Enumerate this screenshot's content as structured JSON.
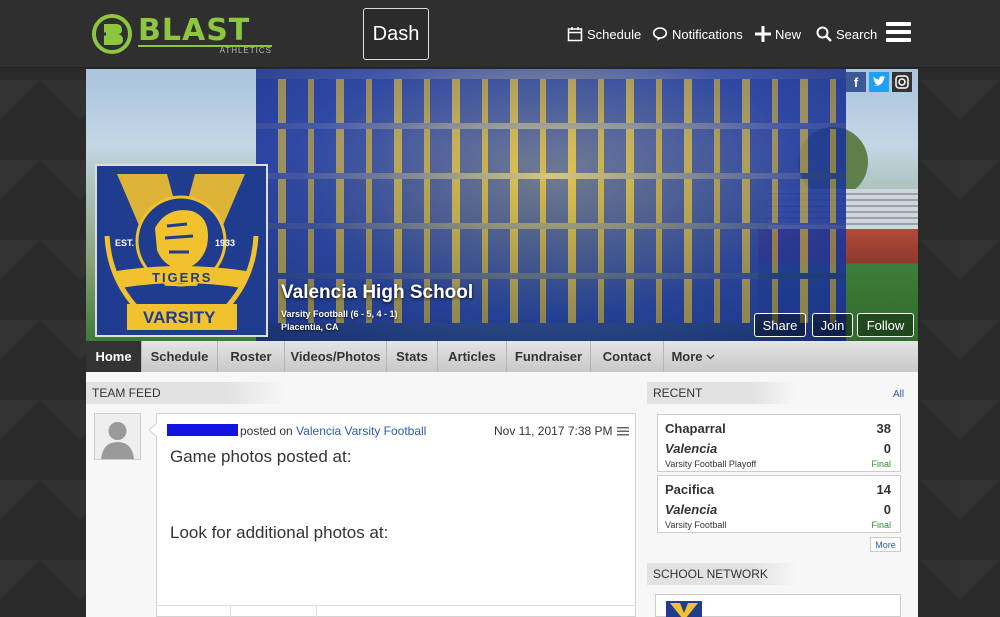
{
  "topbar": {
    "logo_text": "BLAST",
    "logo_sub": "ATHLETICS",
    "dash_label": "Dash",
    "nav": [
      {
        "label": "Schedule",
        "icon": "calendar-icon"
      },
      {
        "label": "Notifications",
        "icon": "bubble-icon"
      },
      {
        "label": "New",
        "icon": "plus-icon"
      },
      {
        "label": "Search",
        "icon": "search-icon"
      }
    ]
  },
  "cover": {
    "school_name": "Valencia High School",
    "record": "Varsity Football (6 - 5, 4 - 1)",
    "location": "Placentia, CA",
    "logo_est": "EST.",
    "logo_year": "1933",
    "logo_tigers": "TIGERS",
    "logo_varsity": "VARSITY",
    "buttons": {
      "share": "Share",
      "join": "Join",
      "follow": "Follow"
    }
  },
  "tabs": [
    "Home",
    "Schedule",
    "Roster",
    "Videos/Photos",
    "Stats",
    "Articles",
    "Fundraiser",
    "Contact",
    "More"
  ],
  "feed": {
    "title": "TEAM FEED",
    "post": {
      "posted_on": "posted on",
      "team_link": "Valencia Varsity Football",
      "date": "Nov 11, 2017 7:38 PM",
      "line1": "Game photos posted at:",
      "line2": "Look for additional photos at:"
    }
  },
  "recent": {
    "title": "RECENT",
    "all_label": "All",
    "games": [
      {
        "home": "Chaparral",
        "home_score": "38",
        "away": "Valencia",
        "away_score": "0",
        "sub": "Varsity Football Playoff",
        "status": "Final"
      },
      {
        "home": "Pacifica",
        "home_score": "14",
        "away": "Valencia",
        "away_score": "0",
        "sub": "Varsity Football",
        "status": "Final"
      }
    ],
    "more_label": "More"
  },
  "network": {
    "title": "SCHOOL NETWORK"
  },
  "colors": {
    "brand_green": "#8dc63f",
    "link_blue": "#2a5db0",
    "final_green": "#2e8b2e",
    "team_blue": "#1f3c8f",
    "team_gold": "#f2c12e"
  }
}
